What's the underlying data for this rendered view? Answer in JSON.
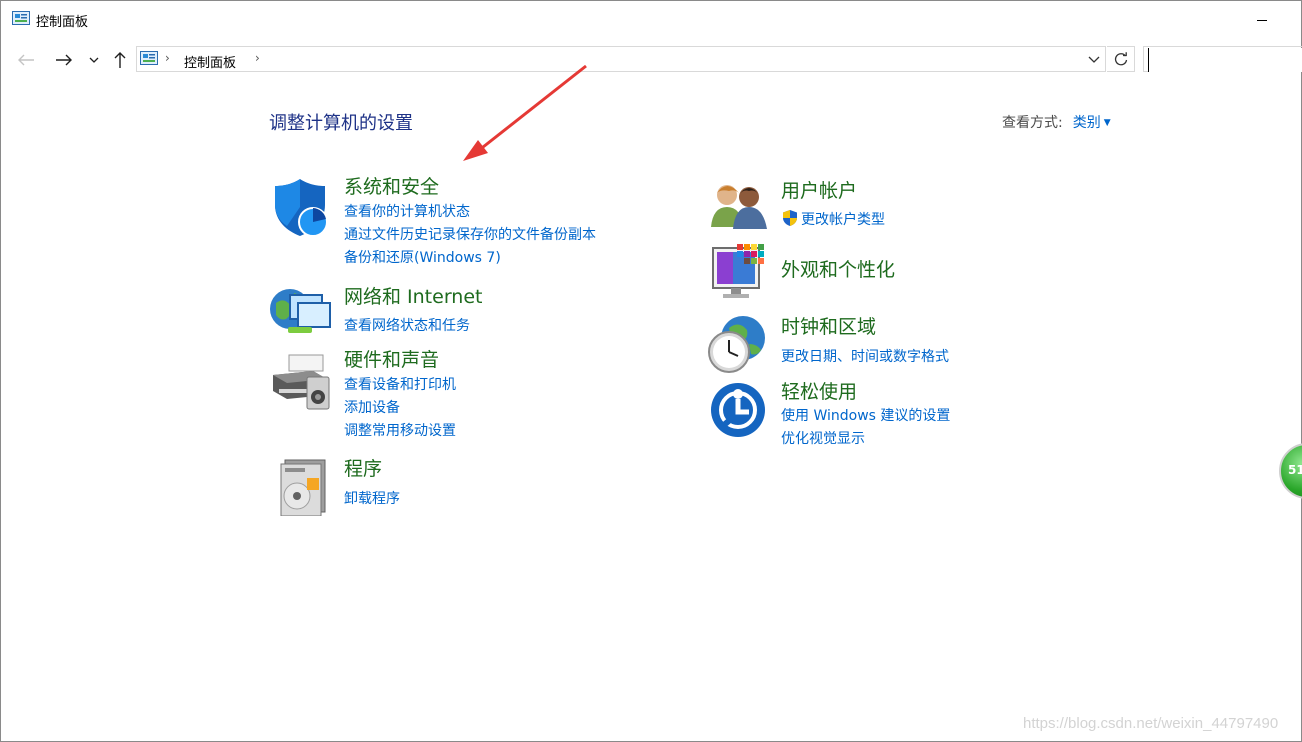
{
  "window": {
    "title": "控制面板"
  },
  "navbar": {
    "back_icon": "back-arrow-icon",
    "forward_icon": "forward-arrow-icon",
    "recent_icon": "chevron-down-icon",
    "up_icon": "up-arrow-icon",
    "breadcrumb": [
      "控制面板"
    ],
    "search_placeholder": ""
  },
  "main": {
    "heading": "调整计算机的设置",
    "view_by_label": "查看方式:",
    "view_by_value": "类别"
  },
  "categories_left": [
    {
      "title": "系统和安全",
      "icon": "system-security-shield-icon",
      "links": [
        "查看你的计算机状态",
        "通过文件历史记录保存你的文件备份副本",
        "备份和还原(Windows 7)"
      ]
    },
    {
      "title": "网络和 Internet",
      "icon": "network-globe-icon",
      "links": [
        "查看网络状态和任务"
      ]
    },
    {
      "title": "硬件和声音",
      "icon": "printer-speaker-icon",
      "links": [
        "查看设备和打印机",
        "添加设备",
        "调整常用移动设置"
      ]
    },
    {
      "title": "程序",
      "icon": "programs-disc-icon",
      "links": [
        "卸载程序"
      ]
    }
  ],
  "categories_right": [
    {
      "title": "用户帐户",
      "icon": "users-icon",
      "links": [
        "更改帐户类型"
      ]
    },
    {
      "title": "外观和个性化",
      "icon": "monitor-personalize-icon",
      "links": []
    },
    {
      "title": "时钟和区域",
      "icon": "clock-globe-icon",
      "links": [
        "更改日期、时间或数字格式"
      ]
    },
    {
      "title": "轻松使用",
      "icon": "ease-of-access-icon",
      "links": [
        "使用 Windows 建议的设置",
        "优化视觉显示"
      ]
    }
  ],
  "overlay": {
    "badge_text": "51",
    "watermark": "https://blog.csdn.net/weixin_44797490",
    "annotation_color": "#e53935"
  }
}
